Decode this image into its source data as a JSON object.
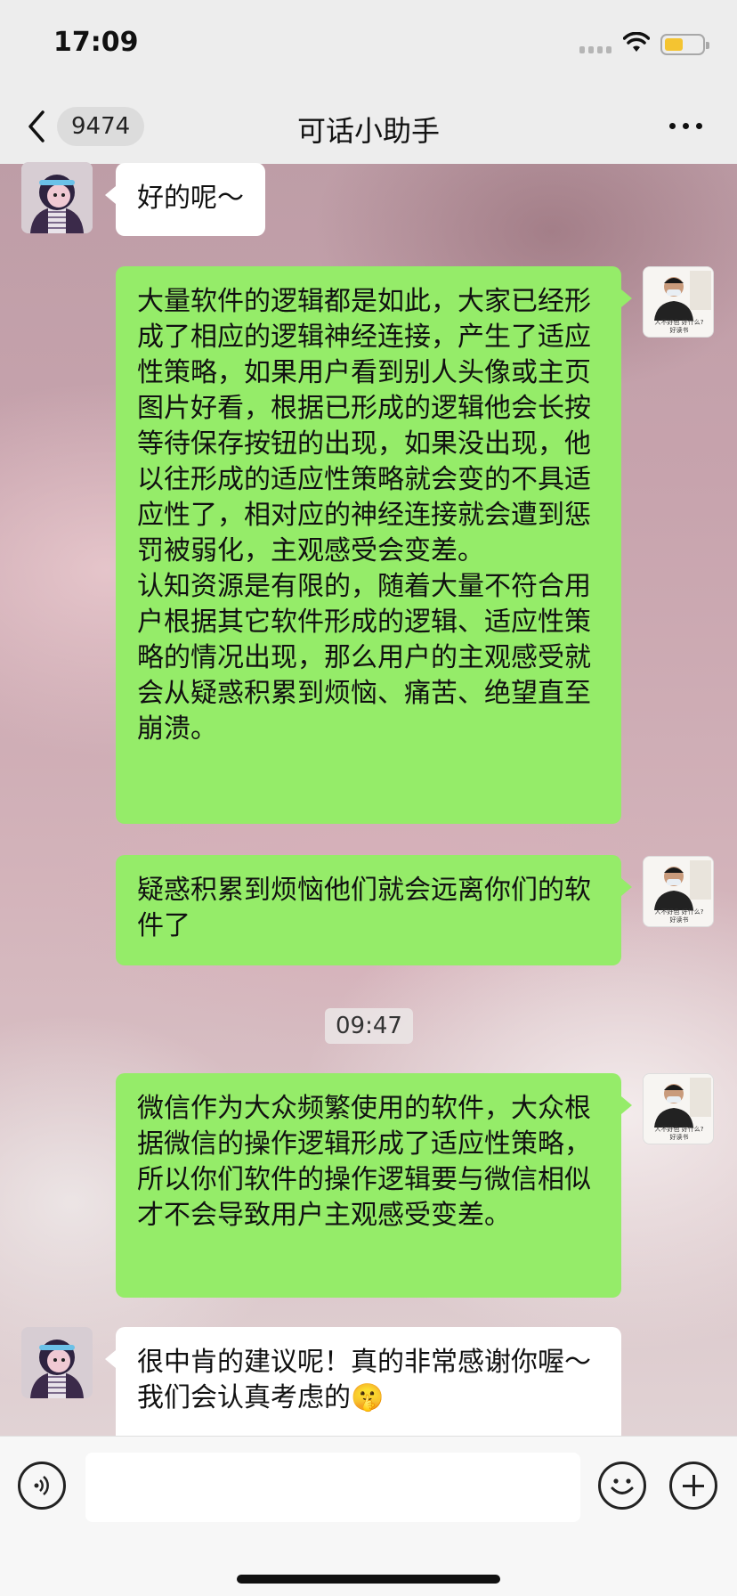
{
  "status": {
    "time": "17:09"
  },
  "nav": {
    "unread_count": "9474",
    "title": "可话小助手"
  },
  "messages": [
    {
      "side": "left",
      "sender": "bot",
      "text": "好的呢～"
    },
    {
      "side": "right",
      "sender": "me",
      "text": "大量软件的逻辑都是如此，大家已经形成了相应的逻辑神经连接，产生了适应性策略，如果用户看到别人头像或主页图片好看，根据已形成的逻辑他会长按等待保存按钮的出现，如果没出现，他以往形成的适应性策略就会变的不具适应性了，相对应的神经连接就会遭到惩罚被弱化，主观感受会变差。\n认知资源是有限的，随着大量不符合用户根据其它软件形成的逻辑、适应性策略的情况出现，那么用户的主观感受就会从疑惑积累到烦恼、痛苦、绝望直至崩溃。"
    },
    {
      "side": "right",
      "sender": "me",
      "text": "疑惑积累到烦恼他们就会远离你们的软件了"
    },
    {
      "side": "right",
      "sender": "me",
      "text": "微信作为大众频繁使用的软件，大众根据微信的操作逻辑形成了适应性策略，所以你们软件的操作逻辑要与微信相似才不会导致用户主观感受变差。"
    },
    {
      "side": "left",
      "sender": "bot",
      "text": "很中肯的建议呢！真的非常感谢你喔～我们会认真考虑的🤫"
    }
  ],
  "timestamp": "09:47",
  "avatar_me_caption": {
    "line1": "人不好色 好什么?",
    "line2": "好读书"
  },
  "colors": {
    "bubble_me": "#95ec69",
    "bubble_bot": "#ffffff",
    "bar_bg": "#ededed"
  }
}
